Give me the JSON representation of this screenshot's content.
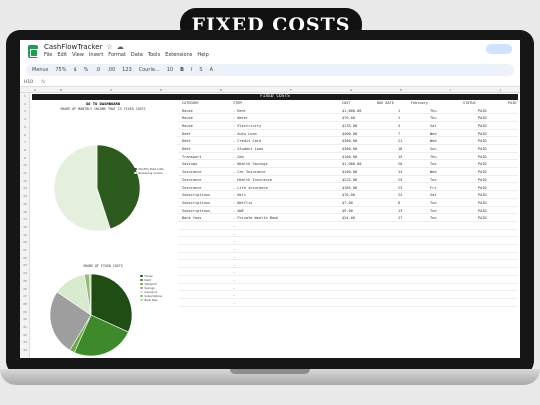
{
  "banner": {
    "title": "FIXED COSTS"
  },
  "app": {
    "doc_title": "CashFlowTracker",
    "menus": [
      "File",
      "Edit",
      "View",
      "Insert",
      "Format",
      "Data",
      "Tools",
      "Extensions",
      "Help"
    ],
    "toolbar": [
      "Menus",
      "75%",
      "$",
      "%",
      ".0",
      ".00",
      "123",
      "Courie...",
      "10",
      "B",
      "I",
      "S",
      "A"
    ],
    "name_box": "H10",
    "fx": "fx"
  },
  "sheet": {
    "header": "FIXED COSTS",
    "dashboard_link": "GO TO DASHBOARD",
    "columns": {
      "category": "CATEGORY",
      "item": "ITEM",
      "cost": "COST",
      "due_date": "DUE DATE",
      "february": "February",
      "status": "STATUS",
      "paid": "PAID"
    },
    "col_letters": [
      "A",
      "B",
      "C",
      "D",
      "E",
      "F",
      "G",
      "H",
      "I",
      "J"
    ],
    "row_numbers": [
      "1",
      "2",
      "3",
      "4",
      "5",
      "6",
      "7",
      "8",
      "9",
      "10",
      "11",
      "12",
      "13",
      "14",
      "15",
      "16",
      "17",
      "18",
      "19",
      "20",
      "21",
      "22",
      "23",
      "24",
      "25",
      "26",
      "27",
      "28",
      "29",
      "30",
      "31",
      "32",
      "33",
      "34"
    ],
    "chart1_title": "SHARE OF MONTHLY INCOME THAT IS FIXED COSTS",
    "chart2_title": "SHARE OF FIXED COSTS",
    "rows": [
      {
        "category": "House",
        "item": "- Rent",
        "cost": "$1,000.00",
        "due": "1",
        "feb": "Thu",
        "status": "PAID",
        "paid": true
      },
      {
        "category": "House",
        "item": "- Water",
        "cost": "$70.00",
        "due": "1",
        "feb": "Thu",
        "status": "PAID",
        "paid": true
      },
      {
        "category": "House",
        "item": "- Electricity",
        "cost": "$135.00",
        "due": "3",
        "feb": "Sat",
        "status": "PAID",
        "paid": true
      },
      {
        "category": "Debt",
        "item": "- Auto Loan",
        "cost": "$400.00",
        "due": "7",
        "feb": "Wed",
        "status": "PAID",
        "paid": true
      },
      {
        "category": "Debt",
        "item": "- Credit Card",
        "cost": "$300.00",
        "due": "21",
        "feb": "Wed",
        "status": "PAID",
        "paid": true
      },
      {
        "category": "Debt",
        "item": "- Student Loan",
        "cost": "$300.00",
        "due": "18",
        "feb": "Sun",
        "status": "PAID",
        "paid": true
      },
      {
        "category": "Transport",
        "item": "- Gas",
        "cost": "$100.00",
        "due": "15",
        "feb": "Thu",
        "status": "PAID",
        "paid": true
      },
      {
        "category": "Savings",
        "item": "- Wealth Savings",
        "cost": "$1,000.00",
        "due": "20",
        "feb": "Tue",
        "status": "PAID",
        "paid": true
      },
      {
        "category": "Insurance",
        "item": "- Car Insurance",
        "cost": "$100.00",
        "due": "14",
        "feb": "Wed",
        "status": "PAID",
        "paid": true
      },
      {
        "category": "Insurance",
        "item": "- Health Insurance",
        "cost": "$225.00",
        "due": "25",
        "feb": "Tue",
        "status": "PAID",
        "paid": true
      },
      {
        "category": "Insurance",
        "item": "- Life insurance",
        "cost": "$185.00",
        "due": "23",
        "feb": "Fri",
        "status": "PAID",
        "paid": true
      },
      {
        "category": "Subscriptions",
        "item": "- Wifi",
        "cost": "$70.00",
        "due": "24",
        "feb": "Sat",
        "status": "PAID",
        "paid": true
      },
      {
        "category": "Subscriptions",
        "item": "- Netflix",
        "cost": "$7.00",
        "due": "6",
        "feb": "Tue",
        "status": "PAID",
        "paid": true
      },
      {
        "category": "Subscriptions",
        "item": "- AWE",
        "cost": "$9.00",
        "due": "13",
        "feb": "Tue",
        "status": "PAID",
        "paid": true
      },
      {
        "category": "Bank fees",
        "item": "- Private Wealth Bank",
        "cost": "$24.00",
        "due": "27",
        "feb": "Tue",
        "status": "PAID",
        "paid": true
      }
    ],
    "empty_rows": 11
  },
  "chart_data": [
    {
      "type": "pie",
      "title": "SHARE OF MONTHLY INCOME THAT IS FIXED COSTS",
      "categories": [
        "Monthly fixed costs",
        "Remaining income"
      ],
      "values": [
        0.45,
        0.55
      ],
      "colors": [
        "#2d5a1d",
        "#e4efdc"
      ]
    },
    {
      "type": "pie",
      "title": "SHARE OF FIXED COSTS",
      "categories": [
        "House",
        "Debt",
        "Transport",
        "Savings",
        "Insurance",
        "Subscriptions",
        "Bank fees"
      ],
      "values": [
        0.32,
        0.25,
        0.02,
        0.26,
        0.13,
        0.02,
        0.006
      ],
      "colors": [
        "#1f4d14",
        "#3e8a2a",
        "#6fa84a",
        "#9e9e9e",
        "#d9ebce",
        "#8fbd74",
        "#b8d8a0"
      ]
    }
  ]
}
